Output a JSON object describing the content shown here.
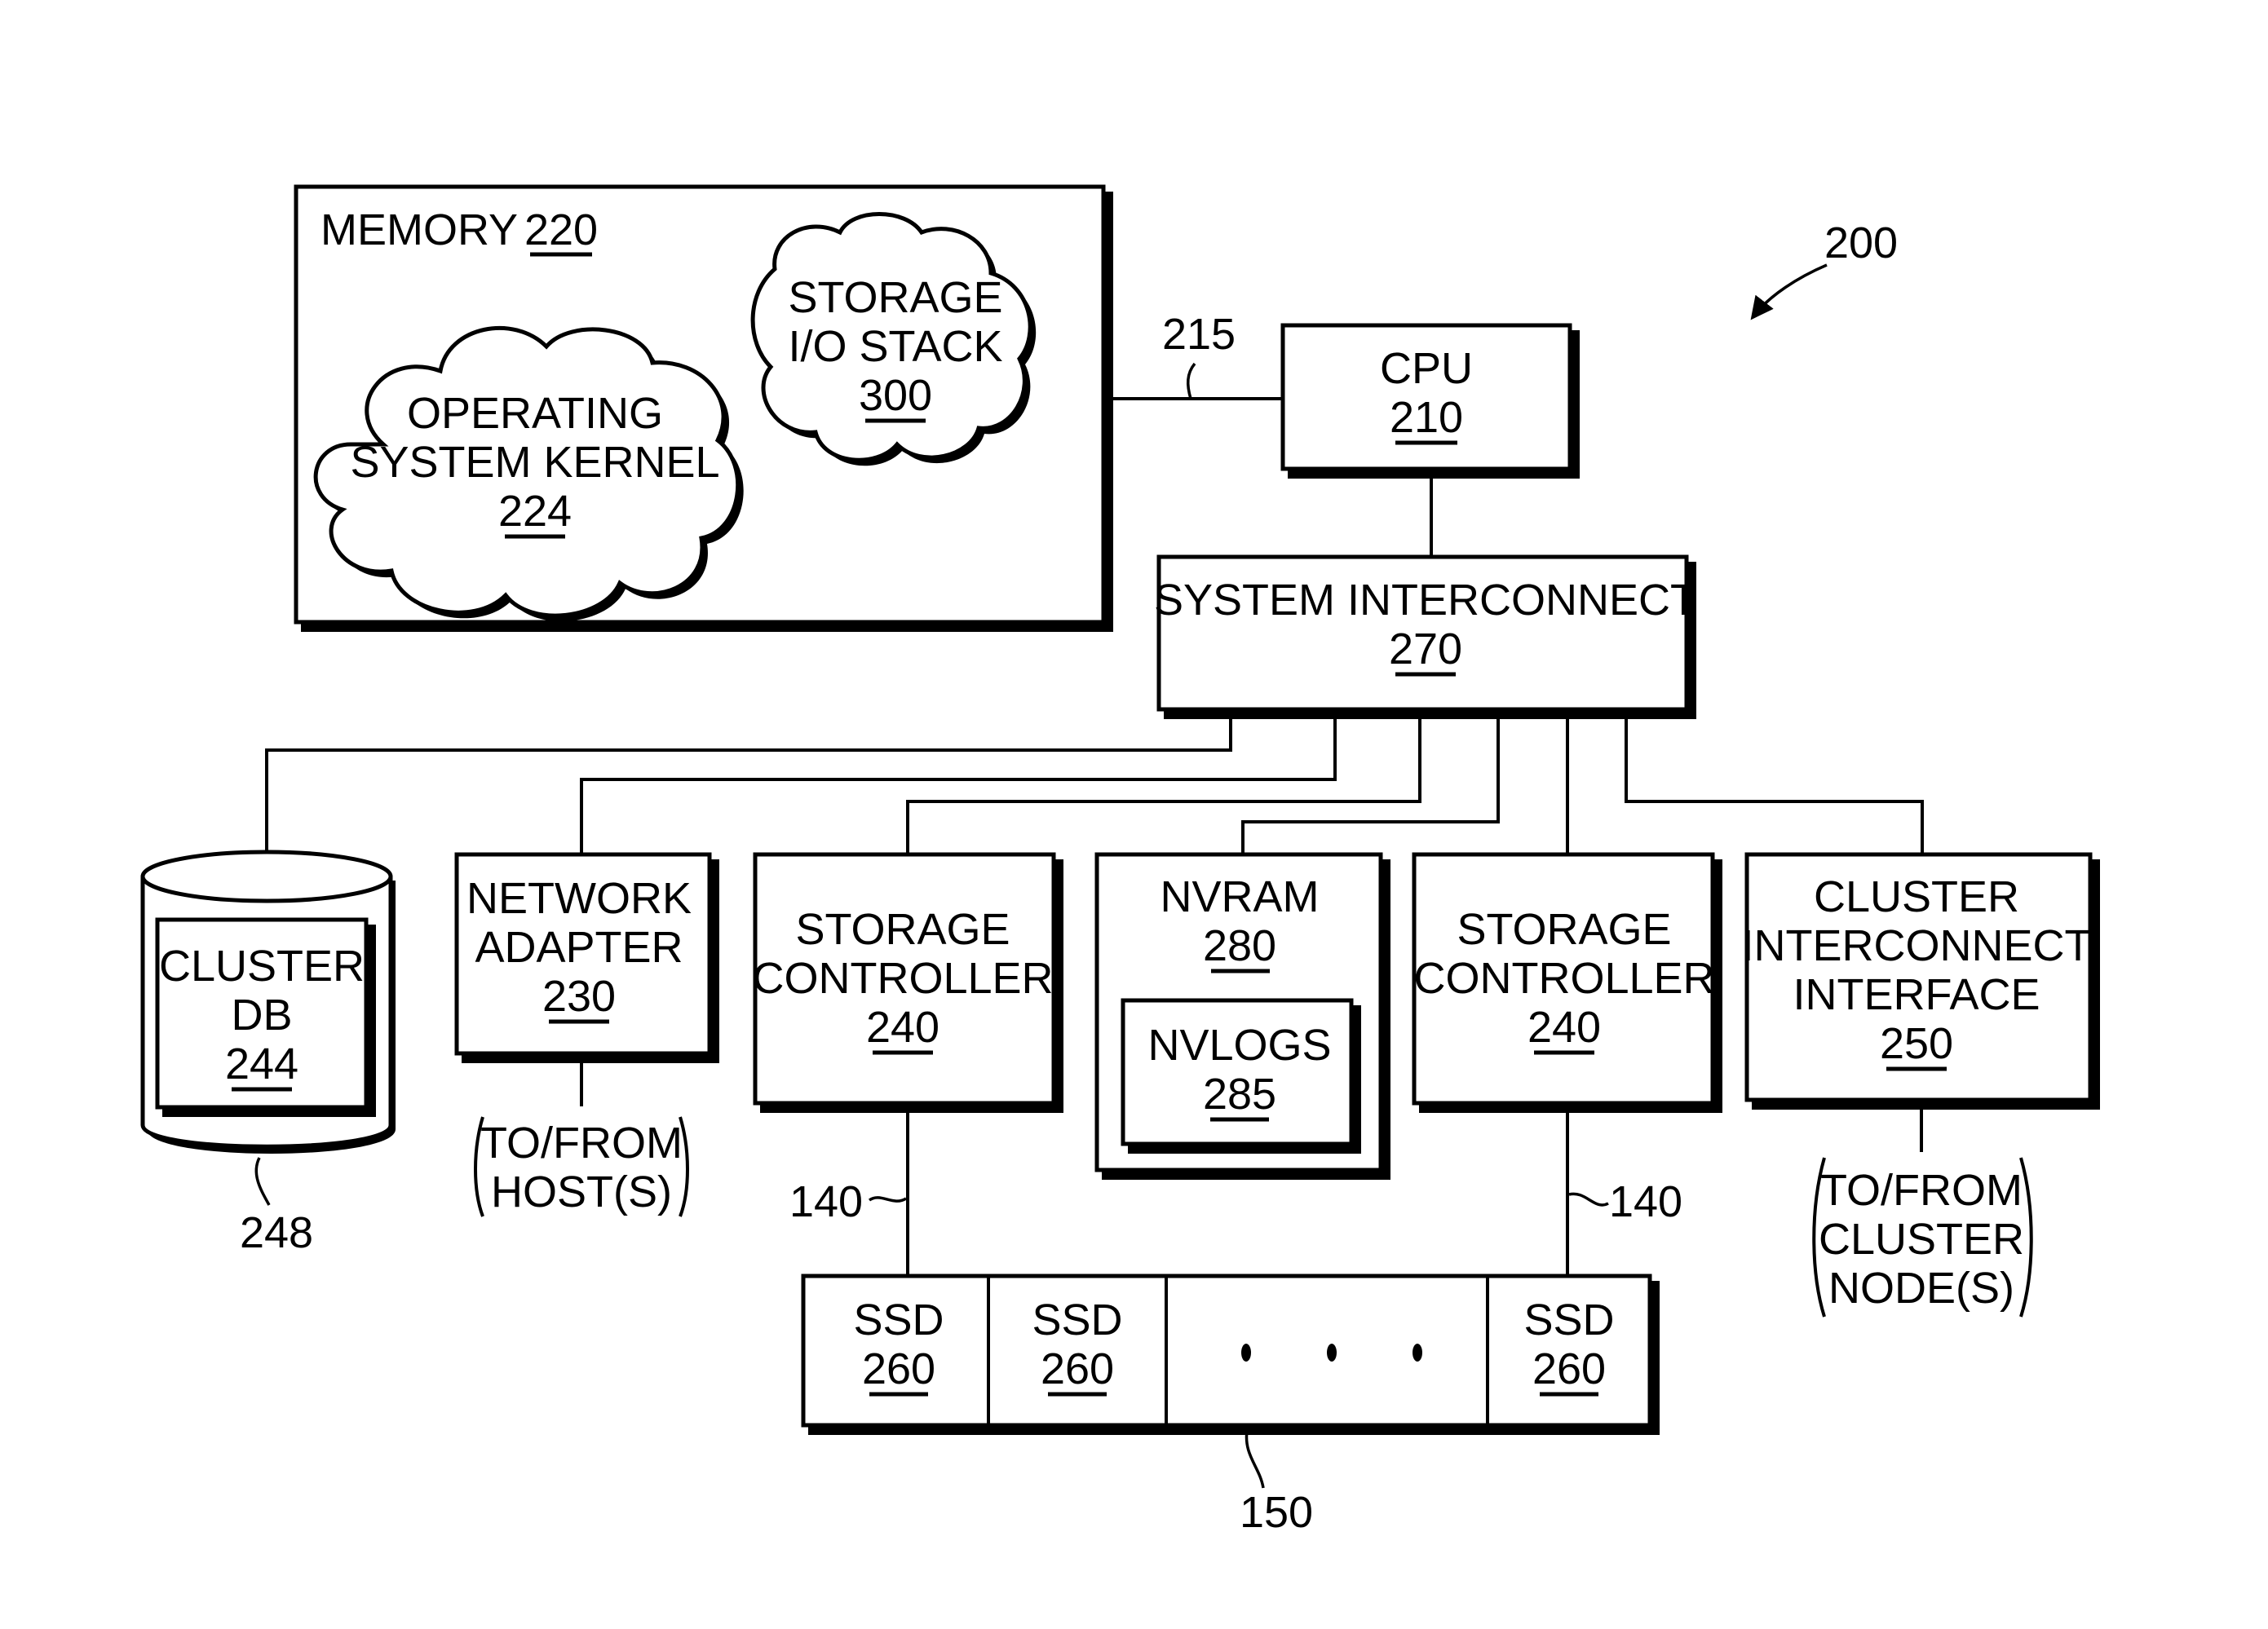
{
  "figure_ref": "200",
  "memory": {
    "label": "MEMORY",
    "ref": "220"
  },
  "os_kernel": {
    "lines": [
      "OPERATING",
      "SYSTEM KERNEL"
    ],
    "ref": "224"
  },
  "io_stack": {
    "lines": [
      "STORAGE",
      "I/O STACK"
    ],
    "ref": "300"
  },
  "bus_ref": "215",
  "cpu": {
    "label": "CPU",
    "ref": "210"
  },
  "interconnect": {
    "label": "SYSTEM INTERCONNECT",
    "ref": "270"
  },
  "cluster_db": {
    "lines": [
      "CLUSTER",
      "DB"
    ],
    "ref": "244",
    "container_ref": "248"
  },
  "network_adapter": {
    "lines": [
      "NETWORK",
      "ADAPTER"
    ],
    "ref": "230",
    "io_lines": [
      "TO/FROM",
      "HOST(S)"
    ]
  },
  "storage_controllers": [
    {
      "lines": [
        "STORAGE",
        "CONTROLLER"
      ],
      "ref": "240",
      "link_ref": "140"
    },
    {
      "lines": [
        "STORAGE",
        "CONTROLLER"
      ],
      "ref": "240",
      "link_ref": "140"
    }
  ],
  "nvram": {
    "label": "NVRAM",
    "ref": "280",
    "nvlogs": {
      "label": "NVLOGS",
      "ref": "285"
    }
  },
  "cluster_interface": {
    "lines": [
      "CLUSTER",
      "INTERCONNECT",
      "INTERFACE"
    ],
    "ref": "250",
    "io_lines": [
      "TO/FROM",
      "CLUSTER",
      "NODE(S)"
    ]
  },
  "ssd_array": {
    "ref": "150",
    "ssds": [
      {
        "label": "SSD",
        "ref": "260"
      },
      {
        "label": "SSD",
        "ref": "260"
      },
      {
        "label": "SSD",
        "ref": "260"
      }
    ],
    "ellipsis": "• • •"
  }
}
